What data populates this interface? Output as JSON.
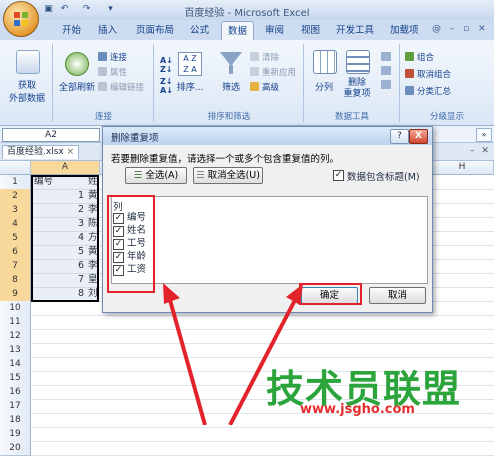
{
  "window": {
    "title": "百度经验 - Microsoft Excel"
  },
  "tabs": [
    "开始",
    "插入",
    "页面布局",
    "公式",
    "数据",
    "审阅",
    "视图",
    "开发工具",
    "加载项"
  ],
  "active_tab": "数据",
  "ribbon": {
    "get_external": [
      "获取",
      "外部数据"
    ],
    "refresh_all": "全部刷新",
    "connections": [
      "连接",
      "属性",
      "编辑链接"
    ],
    "group_connections": "连接",
    "sort": "排序...",
    "filter": "筛选",
    "filter_items": [
      "清除",
      "重新应用",
      "高级"
    ],
    "group_sort_filter": "排序和筛选",
    "split": "分列",
    "remove_dupes": [
      "删除",
      "重复项"
    ],
    "group_data_tools": "数据工具",
    "outline_items": [
      "组合",
      "取消组合",
      "分类汇总"
    ],
    "group_outline": "分级显示"
  },
  "formula_bar": {
    "name_box": "A2"
  },
  "workbook": {
    "name": "百度经验.xlsx"
  },
  "columns": [
    "A",
    "H"
  ],
  "rows": [
    "1",
    "2",
    "3",
    "4",
    "5",
    "6",
    "7",
    "8",
    "9",
    "10",
    "11",
    "12",
    "13",
    "14",
    "15",
    "16",
    "17",
    "18",
    "19",
    "20"
  ],
  "sheet": {
    "a1": "编号",
    "b1": "姓",
    "cells": [
      {
        "a": "1",
        "b": "黄"
      },
      {
        "a": "2",
        "b": "李"
      },
      {
        "a": "3",
        "b": "陈"
      },
      {
        "a": "4",
        "b": "方"
      },
      {
        "a": "5",
        "b": "黄"
      },
      {
        "a": "6",
        "b": "李"
      },
      {
        "a": "7",
        "b": "皇"
      },
      {
        "a": "8",
        "b": "刘"
      }
    ]
  },
  "dialog": {
    "title": "删除重复项",
    "help": "?",
    "close": "X",
    "instruction": "若要删除重复值，请选择一个或多个包含重复值的列。",
    "select_all": "全选(A)",
    "unselect_all": "取消全选(U)",
    "has_headers": "数据包含标题(M)",
    "has_headers_checked": true,
    "list_header": "列",
    "columns": [
      {
        "label": "编号",
        "checked": true
      },
      {
        "label": "姓名",
        "checked": true
      },
      {
        "label": "工号",
        "checked": true
      },
      {
        "label": "年龄",
        "checked": true
      },
      {
        "label": "工资",
        "checked": true
      }
    ],
    "ok": "确定",
    "cancel": "取消"
  },
  "watermark": {
    "text": "技术员联盟",
    "url": "www.jsgho.com"
  },
  "colors": {
    "highlight": "#e3232b",
    "watermark_green": "#2ba43b"
  }
}
